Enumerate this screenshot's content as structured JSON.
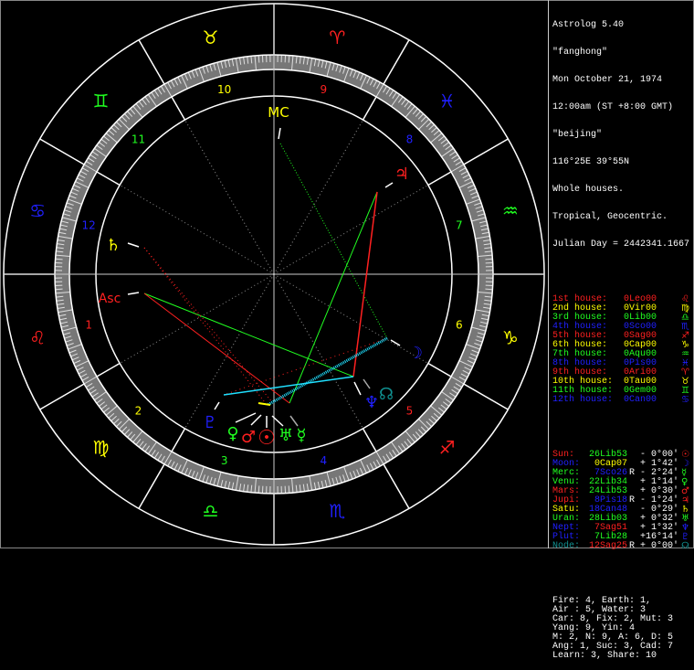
{
  "header": {
    "app": "Astrolog 5.40",
    "name": "\"fanghong\"",
    "date": "Mon October 21, 1974",
    "time": "12:00am (ST +8:00 GMT)",
    "place": "\"beijing\"",
    "coords": "116°25E 39°55N",
    "house_system": "Whole houses.",
    "zodiac": "Tropical, Geocentric.",
    "julian": "Julian Day = 2442341.1667"
  },
  "colors": {
    "fire": "#ff2020",
    "earth": "#ffff00",
    "air": "#20ff20",
    "water": "#2020ff",
    "node": "#109090",
    "white": "#ffffff",
    "gray": "#aaaaaa",
    "cyan": "#20e0ff"
  },
  "houses": [
    {
      "label": "1st house:",
      "pos": "0Leo00",
      "glyph": "♌",
      "el": "fire"
    },
    {
      "label": "2nd house:",
      "pos": "0Vir00",
      "glyph": "♍",
      "el": "earth"
    },
    {
      "label": "3rd house:",
      "pos": "0Lib00",
      "glyph": "♎",
      "el": "air"
    },
    {
      "label": "4th house:",
      "pos": "0Sco00",
      "glyph": "♏",
      "el": "water"
    },
    {
      "label": "5th house:",
      "pos": "0Sag00",
      "glyph": "♐",
      "el": "fire"
    },
    {
      "label": "6th house:",
      "pos": "0Cap00",
      "glyph": "♑",
      "el": "earth"
    },
    {
      "label": "7th house:",
      "pos": "0Aqu00",
      "glyph": "♒",
      "el": "air"
    },
    {
      "label": "8th house:",
      "pos": "0Pis00",
      "glyph": "♓",
      "el": "water"
    },
    {
      "label": "9th house:",
      "pos": "0Ari00",
      "glyph": "♈",
      "el": "fire"
    },
    {
      "label": "10th house:",
      "pos": "0Tau00",
      "glyph": "♉",
      "el": "earth"
    },
    {
      "label": "11th house:",
      "pos": "0Gem00",
      "glyph": "♊",
      "el": "air"
    },
    {
      "label": "12th house:",
      "pos": "0Can00",
      "glyph": "♋",
      "el": "water"
    }
  ],
  "planets": [
    {
      "name": "Sun:",
      "pos": "26Lib53",
      "retro": "",
      "offset": "- 0°00'",
      "glyph": "☉",
      "nc": "fire",
      "pc": "air"
    },
    {
      "name": "Moon:",
      "pos": "0Cap07",
      "retro": "",
      "offset": "+ 1°42'",
      "glyph": "☽",
      "nc": "water",
      "pc": "earth"
    },
    {
      "name": "Merc:",
      "pos": "7Sco26",
      "retro": "R",
      "offset": "- 2°24'",
      "glyph": "☿",
      "nc": "air",
      "pc": "water"
    },
    {
      "name": "Venu:",
      "pos": "22Lib34",
      "retro": "",
      "offset": "+ 1°14'",
      "glyph": "♀",
      "nc": "air",
      "pc": "air"
    },
    {
      "name": "Mars:",
      "pos": "24Lib53",
      "retro": "",
      "offset": "+ 0°30'",
      "glyph": "♂",
      "nc": "fire",
      "pc": "air"
    },
    {
      "name": "Jupi:",
      "pos": "8Pis18",
      "retro": "R",
      "offset": "- 1°24'",
      "glyph": "♃",
      "nc": "fire",
      "pc": "water"
    },
    {
      "name": "Satu:",
      "pos": "18Can48",
      "retro": "",
      "offset": "- 0°29'",
      "glyph": "♄",
      "nc": "earth",
      "pc": "water"
    },
    {
      "name": "Uran:",
      "pos": "28Lib03",
      "retro": "",
      "offset": "+ 0°32'",
      "glyph": "♅",
      "nc": "air",
      "pc": "air"
    },
    {
      "name": "Nept:",
      "pos": "7Sag51",
      "retro": "",
      "offset": "+ 1°32'",
      "glyph": "♆",
      "nc": "water",
      "pc": "fire"
    },
    {
      "name": "Plut:",
      "pos": "7Lib28",
      "retro": "",
      "offset": "+16°14'",
      "glyph": "♇",
      "nc": "water",
      "pc": "air"
    },
    {
      "name": "Node:",
      "pos": "12Sag25",
      "retro": "R",
      "offset": "+ 0°00'",
      "glyph": "☊",
      "nc": "node",
      "pc": "fire"
    }
  ],
  "stats": [
    "Fire: 4, Earth: 1,",
    "Air : 5, Water: 3",
    "Car: 8, Fix: 2, Mut: 3",
    "Yang: 9, Yin: 4",
    "M: 2, N: 9, A: 6, D: 5",
    "Ang: 1, Suc: 3, Cad: 7",
    "Learn: 3, Share: 10"
  ],
  "wheel": {
    "signs": [
      "♈",
      "♉",
      "♊",
      "♋",
      "♌",
      "♍",
      "♎",
      "♏",
      "♐",
      "♑",
      "♒",
      "♓"
    ],
    "house_numbers": [
      "1",
      "2",
      "3",
      "4",
      "5",
      "6",
      "7",
      "8",
      "9",
      "10",
      "11",
      "12"
    ],
    "mc_label": "MC",
    "asc_label": "Asc"
  }
}
